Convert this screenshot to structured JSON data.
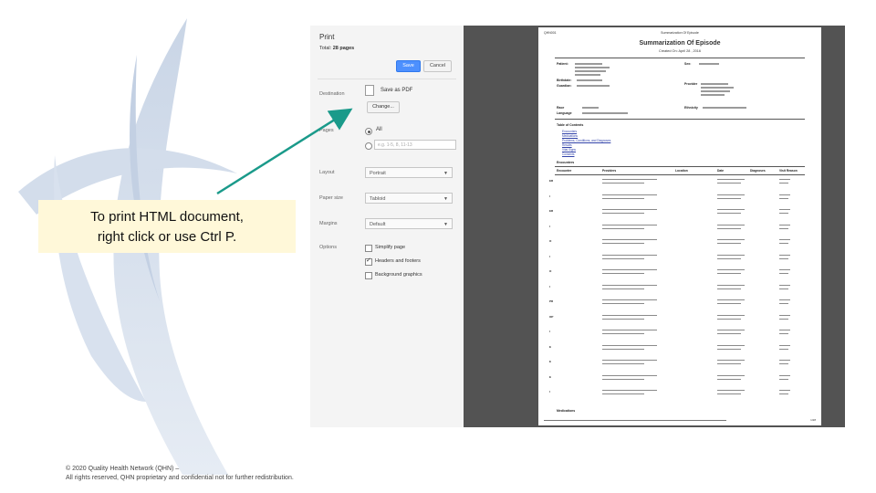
{
  "slide": {
    "caption_line1": "To print HTML document,",
    "caption_line2": "right click or use Ctrl P.",
    "copyright_line1": "© 2020 Quality Health Network (QHN) –",
    "copyright_line2": "All rights reserved, QHN proprietary and confidential not for further redistribution."
  },
  "print_dialog": {
    "title": "Print",
    "total_prefix": "Total: ",
    "total_value": "28 pages",
    "save_label": "Save",
    "cancel_label": "Cancel",
    "destination_label": "Destination",
    "destination_value": "Save as PDF",
    "change_label": "Change...",
    "pages_label": "Pages",
    "pages_all": "All",
    "pages_range_placeholder": "e.g. 1-5, 8, 11-13",
    "layout_label": "Layout",
    "layout_value": "Portrait",
    "paper_size_label": "Paper size",
    "paper_size_value": "Tabloid",
    "margins_label": "Margins",
    "margins_value": "Default",
    "options_label": "Options",
    "option_simplify": "Simplify page",
    "option_headers": "Headers and footers",
    "option_background": "Background graphics",
    "option_headers_checked": true
  },
  "preview": {
    "header_left": "QHN001",
    "header_center": "Summarization Of Episode",
    "doc_title": "Summarization Of Episode",
    "created_on": "Created On: April 28 , 2016",
    "patient_label": "Patient:",
    "birthdate_label": "Birthdate:",
    "guardian_label": "Guardian:",
    "race_label": "Race",
    "language_label": "Language",
    "sex_label": "Sex:",
    "provider_label": "Provider",
    "ethnicity_label": "Ethnicity",
    "toc_label": "Table of Contents",
    "toc_items": [
      "Encounters",
      "Medications",
      "Problems, Conditions, and Diagnoses",
      "Results",
      "Vital Signs",
      "Consents"
    ],
    "encounters_label": "Encounters",
    "col_encounter": "Encounter",
    "col_providers": "Providers",
    "col_location": "Location",
    "col_date": "Date",
    "col_diagnoses": "Diagnoses",
    "col_visit_reason": "Visit Reason",
    "row_codes": [
      "ER",
      "I",
      "ER",
      "I",
      "O",
      "I",
      "O",
      "I",
      "PR",
      "OP",
      "I",
      "E",
      "E",
      "E",
      "I"
    ],
    "medications_label": "Medications",
    "page_number": "1/28"
  }
}
